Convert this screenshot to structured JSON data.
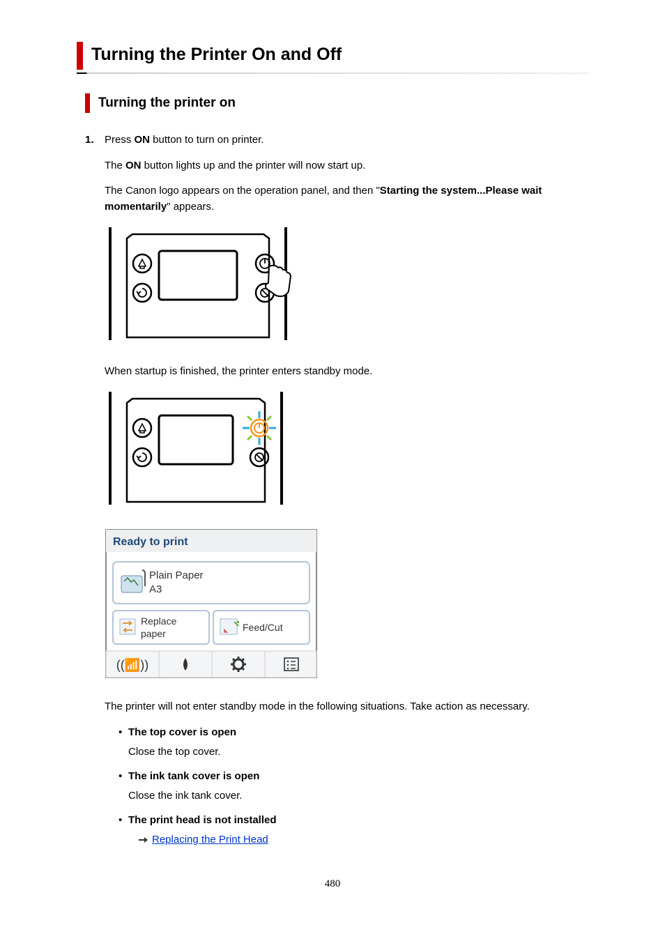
{
  "page": {
    "h1": "Turning the Printer On and Off",
    "h2": "Turning the printer on",
    "step_number": "1.",
    "step_title_pre": "Press ",
    "step_title_bold": "ON",
    "step_title_post": " button to turn on printer.",
    "p1_pre": "The ",
    "p1_bold": "ON",
    "p1_post": " button lights up and the printer will now start up.",
    "p2_pre": "The Canon logo appears on the operation panel, and then \"",
    "p2_bold": "Starting the system...Please wait momentarily",
    "p2_post": "\" appears.",
    "p3": "When startup is finished, the printer enters standby mode.",
    "screen": {
      "status": "Ready to print",
      "paper_type": "Plain Paper",
      "paper_size": "A3",
      "btn_replace_line1": "Replace",
      "btn_replace_line2": "paper",
      "btn_feed": "Feed/Cut"
    },
    "p4": "The printer will not enter standby mode in the following situations. Take action as necessary.",
    "bullets": [
      {
        "title": "The top cover is open",
        "body": "Close the top cover.",
        "link": null
      },
      {
        "title": "The ink tank cover is open",
        "body": "Close the ink tank cover.",
        "link": null
      },
      {
        "title": "The print head is not installed",
        "body": null,
        "link": "Replacing the Print Head"
      }
    ],
    "page_number": "480"
  }
}
